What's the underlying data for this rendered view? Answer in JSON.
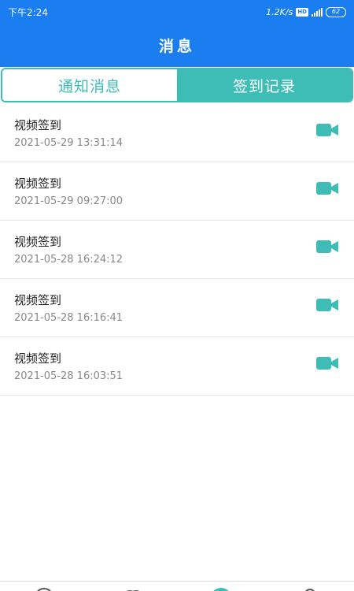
{
  "status_bar": {
    "time": "下午2:24",
    "network_speed": "1.2K/s",
    "hd_label": "HD",
    "network_type": "4G",
    "battery_level": "62"
  },
  "header": {
    "title": "消息"
  },
  "tabs": [
    {
      "label": "通知消息",
      "active": false
    },
    {
      "label": "签到记录",
      "active": true
    }
  ],
  "records": [
    {
      "title": "视频签到",
      "time": "2021-05-29 13:31:14",
      "icon": "video-camera-icon"
    },
    {
      "title": "视频签到",
      "time": "2021-05-29 09:27:00",
      "icon": "video-camera-icon"
    },
    {
      "title": "视频签到",
      "time": "2021-05-28 16:24:12",
      "icon": "video-camera-icon"
    },
    {
      "title": "视频签到",
      "time": "2021-05-28 16:16:41",
      "icon": "video-camera-icon"
    },
    {
      "title": "视频签到",
      "time": "2021-05-28 16:03:51",
      "icon": "video-camera-icon"
    }
  ],
  "colors": {
    "primary_blue": "#1a7ef0",
    "accent_teal": "#3dbdb5"
  }
}
